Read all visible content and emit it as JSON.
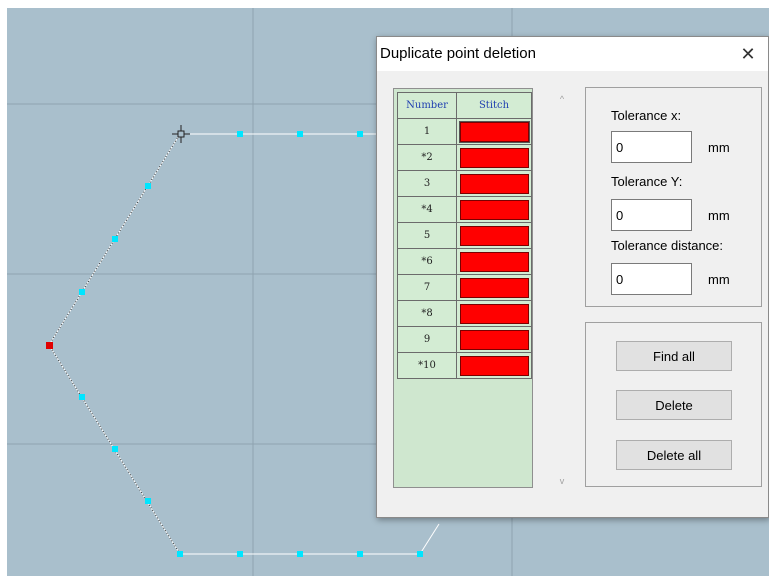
{
  "dialog": {
    "title": "Duplicate point deletion",
    "close_glyph": "✕"
  },
  "table": {
    "headers": [
      "Number",
      "Stitch"
    ],
    "rows": [
      {
        "number": "1",
        "stitch_color": "#ff0000"
      },
      {
        "number": "*2",
        "stitch_color": "#ff0000"
      },
      {
        "number": "3",
        "stitch_color": "#ff0000"
      },
      {
        "number": "*4",
        "stitch_color": "#ff0000"
      },
      {
        "number": "5",
        "stitch_color": "#ff0000"
      },
      {
        "number": "*6",
        "stitch_color": "#ff0000"
      },
      {
        "number": "7",
        "stitch_color": "#ff0000"
      },
      {
        "number": "*8",
        "stitch_color": "#ff0000"
      },
      {
        "number": "9",
        "stitch_color": "#ff0000"
      },
      {
        "number": "*10",
        "stitch_color": "#ff0000"
      }
    ]
  },
  "scrollbar": {
    "up_glyph": "^",
    "down_glyph": "v"
  },
  "tolerance": {
    "x_label": "Tolerance x:",
    "x_value": "0",
    "y_label": "Tolerance Y:",
    "y_value": "0",
    "distance_label": "Tolerance distance:",
    "distance_value": "0",
    "unit": "mm"
  },
  "buttons": {
    "find_all": "Find all",
    "delete": "Delete",
    "delete_all": "Delete all"
  },
  "colors": {
    "canvas_bg": "#a9bfcc",
    "point": "#00e5ff",
    "selected_point": "#e00000",
    "path_line": "#ffffff",
    "table_bg": "#cfe7cf"
  }
}
